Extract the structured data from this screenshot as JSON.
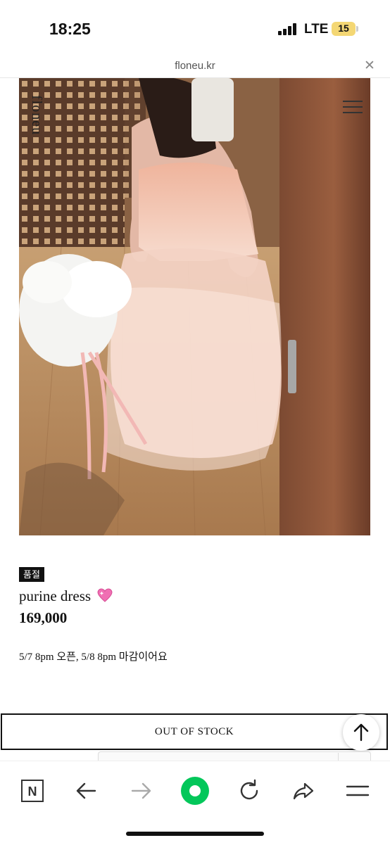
{
  "status_bar": {
    "time": "18:25",
    "network": "LTE",
    "battery": "15",
    "battery_color": "#f4d774"
  },
  "browser": {
    "url": "floneu.kr",
    "close_icon": "close-icon"
  },
  "site": {
    "brand": "floneu",
    "menu_icon": "hamburger-menu-icon"
  },
  "product": {
    "badge": "품절",
    "name": "purine dress",
    "emoji_icon": "sparkling-heart-icon",
    "price": "169,000",
    "notice": "5/7 8pm 오픈, 5/8 8pm 마감이어요",
    "button_label": "OUT OF STOCK"
  },
  "scroll_top_icon": "arrow-up-icon",
  "toolbar": {
    "items": [
      "naver-n-icon",
      "back-arrow-icon",
      "forward-arrow-icon",
      "green-dot-icon",
      "reload-icon",
      "share-icon",
      "menu-lines-icon"
    ],
    "accent": "#03c75a"
  }
}
